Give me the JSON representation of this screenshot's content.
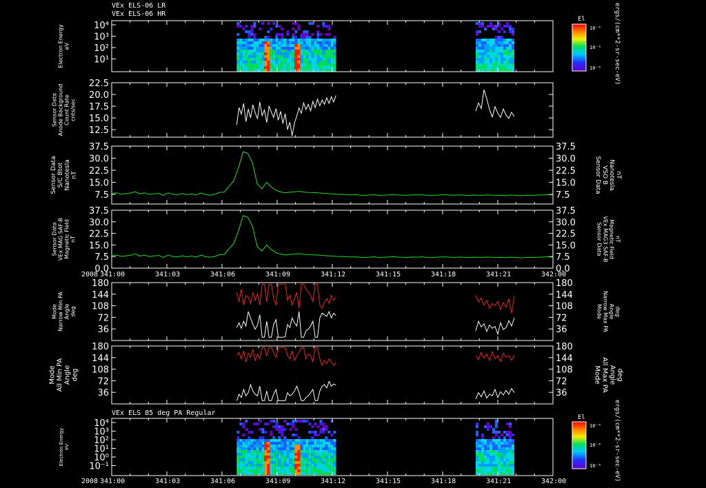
{
  "header": {
    "line1": "VEx ELS-06 LR",
    "line2": "VEx ELS-06 HR",
    "bottom_title": "VEx ELS 85 deg PA Regular"
  },
  "colors": {
    "background": "#000000",
    "axis": "#ffffff",
    "line_white": "#ffffff",
    "line_green": "#22dd22",
    "line_red": "#ee2222"
  },
  "colorbar": {
    "title": "El",
    "units": "ergs/(cm**2-sr-sec-eV)",
    "ticks": [
      "10⁻⁴",
      "10⁻⁶",
      "10⁻⁸"
    ]
  },
  "time_axis": {
    "year": "2008",
    "ticks": [
      "341:00",
      "341:03",
      "341:06",
      "341:09",
      "341:12",
      "341:15",
      "341:18",
      "341:21",
      "342:00"
    ]
  },
  "chart_data": [
    {
      "id": "panel1",
      "type": "heatmap",
      "ylabel": [
        "Electron Energy",
        "eV"
      ],
      "y_ticks": [
        "10⁴",
        "10³",
        "10²",
        "10¹"
      ],
      "scale": "log",
      "data_intervals": [
        [
          "341:06.8",
          "341:12.2"
        ],
        [
          "341:19.8",
          "341:21.9"
        ]
      ]
    },
    {
      "id": "panel2",
      "type": "line",
      "ylabel": [
        "Sensor Data",
        "Anode Background",
        "Count Rate",
        "cnts/sec"
      ],
      "ylim": [
        10.9,
        22.5
      ],
      "y_ticks": [
        "22.5",
        "20.0",
        "17.5",
        "15.0",
        "12.5"
      ],
      "series": [
        {
          "color": "#ffffff",
          "segments": [
            {
              "t0": 6.8,
              "t1": 12.2,
              "values": [
                13.5,
                17.2,
                15.8,
                18.1,
                14.2,
                16.9,
                15.0,
                17.8,
                16.1,
                14.8,
                18.4,
                15.5,
                16.7,
                14.0,
                17.5,
                16.2,
                15.1,
                17.0,
                14.5,
                16.4,
                13.8,
                15.9,
                12.5,
                14.1,
                11.2,
                13.9,
                15.4,
                17.1,
                16.0,
                18.2,
                16.8,
                17.9,
                16.5,
                18.5,
                17.2,
                19.0,
                17.6,
                18.8,
                17.9,
                19.3,
                18.1,
                19.5,
                18.4,
                19.8
              ]
            },
            {
              "t0": 19.8,
              "t1": 21.9,
              "values": [
                16.5,
                18.2,
                17.0,
                21.0,
                19.1,
                16.8,
                15.2,
                17.4,
                16.0,
                15.1,
                16.9,
                15.6,
                14.9,
                16.2,
                15.3
              ]
            }
          ]
        }
      ]
    },
    {
      "id": "panel3",
      "type": "line",
      "ylabel": [
        "Sensor Data",
        "S/C Btot",
        "Nanotesla",
        "nT"
      ],
      "ylabel_right": [
        "Sensor Data",
        "VSO B",
        "Nanotesla",
        "nT"
      ],
      "ylim": [
        1.5,
        37.5
      ],
      "y_ticks": [
        "37.5",
        "30.0",
        "22.5",
        "15.0",
        "7.5"
      ],
      "series": [
        {
          "color": "#22dd22",
          "segments": [
            {
              "t0": 0,
              "t1": 24,
              "values": [
                8.1,
                8.5,
                7.6,
                7.9,
                8.3,
                9.2,
                7.8,
                8.4,
                7.5,
                7.9,
                8.2,
                6.9,
                8.4,
                7.6,
                7.2,
                8.0,
                7.3,
                7.8,
                7.1,
                8.4,
                7.4,
                7.0,
                7.6,
                8.8,
                8.9,
                12.5,
                16.0,
                24.0,
                34.0,
                33.0,
                27.0,
                14.0,
                11.0,
                15.0,
                12.0,
                10.0,
                9.0,
                8.5,
                8.9,
                9.1,
                9.4,
                8.9,
                8.7,
                8.6,
                8.5,
                8.2,
                8.0,
                7.8,
                7.6,
                7.5,
                7.4,
                7.2,
                7.3,
                7.0,
                6.9,
                7.1,
                7.3,
                6.8,
                7.0,
                7.2,
                7.4,
                7.1,
                7.0,
                6.9,
                7.2,
                7.1,
                7.3,
                7.0,
                6.8,
                7.0,
                7.2,
                7.3,
                7.1,
                6.9,
                7.2,
                7.0,
                6.8,
                7.1,
                7.0,
                6.9,
                7.2,
                7.0,
                6.9,
                7.0,
                6.8,
                7.1,
                6.9,
                6.7,
                6.8,
                7.0,
                6.9,
                7.1,
                7.2,
                7.3,
                7.1
              ]
            }
          ]
        }
      ]
    },
    {
      "id": "panel4",
      "type": "line",
      "ylabel": [
        "Sensor Data",
        "VEx MAG SAF-B",
        "Magnetic Field",
        "nT"
      ],
      "ylabel_right": [
        "Sensor Data",
        "VEx MAG3 SAF-B",
        "Magnetic Field",
        "nT"
      ],
      "ylim": [
        0,
        37.5
      ],
      "y_ticks": [
        "37.5",
        "30.0",
        "22.5",
        "15.0",
        "7.5",
        "0.0"
      ],
      "series": [
        {
          "color": "#22dd22",
          "segments": [
            {
              "t0": 0,
              "t1": 24,
              "values": [
                8.1,
                8.5,
                7.6,
                7.9,
                8.3,
                9.2,
                7.8,
                8.4,
                7.5,
                7.9,
                8.2,
                6.9,
                8.4,
                7.6,
                7.2,
                8.0,
                7.3,
                7.8,
                7.1,
                8.4,
                7.4,
                7.0,
                7.6,
                8.8,
                8.9,
                12.5,
                16.0,
                24.0,
                34.0,
                33.0,
                27.0,
                14.0,
                11.0,
                15.0,
                12.0,
                10.0,
                9.0,
                8.5,
                8.9,
                9.1,
                9.4,
                8.9,
                8.7,
                8.6,
                8.5,
                8.2,
                8.0,
                7.8,
                7.6,
                7.5,
                7.4,
                7.2,
                7.3,
                7.0,
                6.9,
                7.1,
                7.3,
                6.8,
                7.0,
                7.2,
                7.4,
                7.1,
                7.0,
                6.9,
                7.2,
                7.1,
                7.3,
                7.0,
                6.8,
                7.0,
                7.2,
                7.3,
                7.1,
                6.9,
                7.2,
                7.0,
                6.8,
                7.1,
                7.0,
                6.9,
                7.2,
                7.0,
                6.9,
                7.0,
                6.8,
                7.1,
                6.9,
                6.7,
                6.8,
                7.0,
                6.9,
                7.1,
                7.2,
                7.3,
                7.1
              ]
            }
          ]
        }
      ]
    },
    {
      "id": "panel5",
      "type": "line",
      "ylabel": [
        "Mode",
        "Narrow Min PA",
        "Angle",
        "deg"
      ],
      "ylabel_right": [
        "Mode",
        "Narrow Max PA",
        "Angle",
        "deg"
      ],
      "ylim": [
        0,
        180
      ],
      "y_ticks": [
        "180",
        "144",
        "108",
        "72",
        "36"
      ],
      "series": [
        {
          "color": "#ffffff",
          "segments": [
            {
              "t0": 6.8,
              "t1": 12.2,
              "values": [
                40,
                55,
                38,
                60,
                45,
                90,
                70,
                50,
                35,
                48,
                80,
                10,
                10,
                60,
                10,
                10,
                50,
                65,
                10,
                10,
                10,
                12,
                50,
                40,
                70,
                55,
                45,
                90,
                10,
                10,
                30,
                35,
                45,
                60,
                10,
                10,
                70,
                85,
                80,
                75,
                90,
                70,
                85,
                78
              ]
            },
            {
              "t0": 19.8,
              "t1": 21.9,
              "values": [
                30,
                60,
                42,
                52,
                28,
                48,
                38,
                44,
                20,
                55,
                34,
                40,
                62,
                45,
                70
              ]
            }
          ]
        },
        {
          "color": "#ee2222",
          "segments": [
            {
              "t0": 6.8,
              "t1": 12.2,
              "values": [
                150,
                120,
                160,
                110,
                140,
                135,
                115,
                150,
                125,
                145,
                110,
                175,
                175,
                120,
                175,
                175,
                130,
                110,
                175,
                175,
                175,
                175,
                125,
                140,
                110,
                130,
                150,
                100,
                175,
                175,
                160,
                150,
                140,
                120,
                175,
                175,
                110,
                100,
                120,
                130,
                115,
                140,
                125,
                135
              ]
            },
            {
              "t0": 19.8,
              "t1": 21.9,
              "values": [
                140,
                120,
                132,
                110,
                125,
                100,
                115,
                108,
                122,
                96,
                118,
                104,
                130,
                85,
                140
              ]
            }
          ]
        }
      ]
    },
    {
      "id": "panel6",
      "type": "line",
      "ylabel": [
        "Mode",
        "All Min PA",
        "Angle",
        "deg"
      ],
      "ylabel_right": [
        "Mode",
        "All Max PA",
        "Angle",
        "deg"
      ],
      "ylim": [
        0,
        180
      ],
      "y_ticks": [
        "180",
        "144",
        "108",
        "72",
        "36"
      ],
      "series": [
        {
          "color": "#ffffff",
          "segments": [
            {
              "t0": 6.8,
              "t1": 12.2,
              "values": [
                10,
                30,
                20,
                45,
                25,
                35,
                60,
                40,
                30,
                25,
                55,
                10,
                10,
                40,
                10,
                10,
                30,
                45,
                10,
                10,
                10,
                10,
                35,
                25,
                30,
                40,
                55,
                35,
                10,
                10,
                20,
                25,
                35,
                45,
                10,
                10,
                40,
                55,
                60,
                50,
                70,
                55,
                62,
                58
              ]
            },
            {
              "t0": 19.8,
              "t1": 21.9,
              "values": [
                15,
                35,
                22,
                40,
                18,
                30,
                25,
                45,
                20,
                38,
                28,
                42,
                30,
                48,
                35
              ]
            }
          ]
        },
        {
          "color": "#ee2222",
          "segments": [
            {
              "t0": 6.8,
              "t1": 12.2,
              "values": [
                150,
                160,
                140,
                165,
                130,
                158,
                145,
                170,
                135,
                155,
                140,
                175,
                175,
                150,
                175,
                175,
                160,
                145,
                175,
                175,
                175,
                175,
                150,
                140,
                165,
                135,
                150,
                160,
                175,
                175,
                140,
                155,
                150,
                130,
                175,
                175,
                140,
                120,
                135,
                125,
                140,
                130,
                120,
                128
              ]
            },
            {
              "t0": 19.8,
              "t1": 21.9,
              "values": [
                150,
                138,
                160,
                142,
                155,
                135,
                162,
                140,
                150,
                132,
                158,
                145,
                150,
                136,
                152
              ]
            }
          ]
        }
      ]
    },
    {
      "id": "panel7",
      "type": "heatmap",
      "ylabel": [
        "Electron Energy",
        "eV"
      ],
      "y_ticks": [
        "10⁴",
        "10³",
        "10²",
        "10¹",
        "10⁰",
        "10⁻¹"
      ],
      "scale": "log",
      "data_intervals": [
        [
          "341:06.8",
          "341:12.2"
        ],
        [
          "341:19.8",
          "341:21.9"
        ]
      ]
    }
  ]
}
